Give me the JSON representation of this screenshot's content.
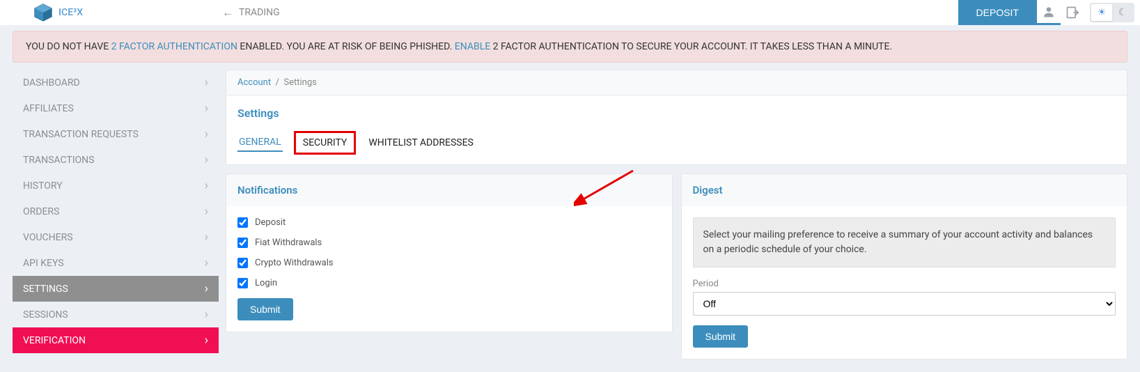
{
  "topbar": {
    "brand": "ICE³X",
    "nav_label": "TRADING",
    "deposit": "DEPOSIT"
  },
  "alert": {
    "pre": "YOU DO NOT HAVE ",
    "link1": "2 FACTOR AUTHENTICATION",
    "mid": " ENABLED. YOU ARE AT RISK OF BEING PHISHED. ",
    "link2": "ENABLE",
    "post": " 2 FACTOR AUTHENTICATION TO SECURE YOUR ACCOUNT. IT TAKES LESS THAN A MINUTE."
  },
  "sidebar": {
    "items": [
      "DASHBOARD",
      "AFFILIATES",
      "TRANSACTION REQUESTS",
      "TRANSACTIONS",
      "HISTORY",
      "ORDERS",
      "VOUCHERS",
      "API KEYS",
      "SETTINGS",
      "SESSIONS",
      "VERIFICATION"
    ]
  },
  "breadcrumb": {
    "a": "Account",
    "sep": "/",
    "b": "Settings"
  },
  "settings": {
    "title": "Settings",
    "tabs": {
      "general": "GENERAL",
      "security": "SECURITY",
      "whitelist": "WHITELIST ADDRESSES"
    }
  },
  "notifications": {
    "title": "Notifications",
    "items": [
      "Deposit",
      "Fiat Withdrawals",
      "Crypto Withdrawals",
      "Login"
    ],
    "submit": "Submit"
  },
  "digest": {
    "title": "Digest",
    "desc": "Select your mailing preference to receive a summary of your account activity and balances on a periodic schedule of your choice.",
    "period_label": "Period",
    "period_value": "Off",
    "submit": "Submit"
  }
}
